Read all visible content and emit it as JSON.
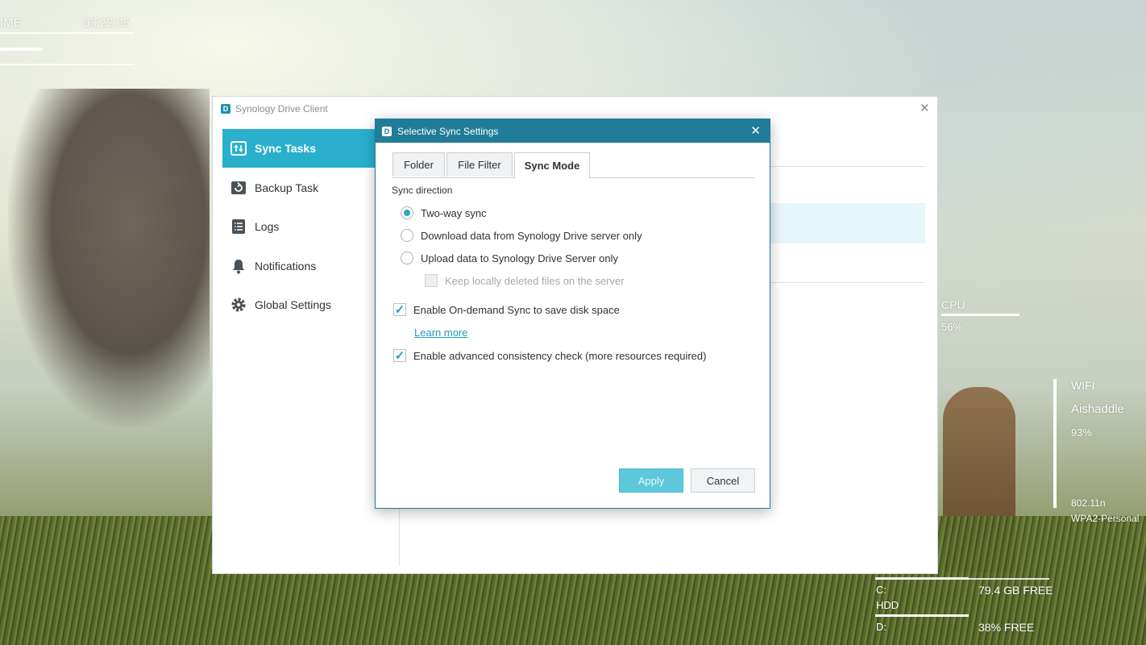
{
  "desktop": {
    "clock_label": "IME",
    "clock_time": "03:22:05",
    "cpu_label": "CPU",
    "cpu_value": "56%",
    "wifi_label": "WIFI",
    "wifi_network": "Aishaddle",
    "wifi_signal": "93%",
    "wifi_standard": "802.11n",
    "wifi_security": "WPA2-Personal",
    "drive_c_label": "C:",
    "drive_c_free": "79.4 GB FREE",
    "hdd_label": "HDD",
    "drive_d_label": "D:",
    "drive_d_free": "38% FREE"
  },
  "main_window": {
    "title": "Synology Drive Client",
    "logo_letter": "D",
    "close_icon": "close-icon",
    "nav": [
      {
        "label": "Sync Tasks",
        "icon": "sync-icon",
        "active": true
      },
      {
        "label": "Backup Task",
        "icon": "backup-icon",
        "active": false
      },
      {
        "label": "Logs",
        "icon": "logs-icon",
        "active": false
      },
      {
        "label": "Notifications",
        "icon": "bell-icon",
        "active": false
      },
      {
        "label": "Global Settings",
        "icon": "gear-icon",
        "active": false
      }
    ]
  },
  "dialog": {
    "title": "Selective Sync Settings",
    "logo_letter": "D",
    "tabs": [
      {
        "label": "Folder",
        "active": false
      },
      {
        "label": "File Filter",
        "active": false
      },
      {
        "label": "Sync Mode",
        "active": true
      }
    ],
    "section_label": "Sync direction",
    "options": {
      "two_way": "Two-way sync",
      "download_only": "Download data from Synology Drive server only",
      "upload_only": "Upload data to Synology Drive Server only",
      "keep_deleted": "Keep locally deleted files on the server",
      "on_demand": "Enable On-demand Sync to save disk space",
      "learn_more": "Learn more",
      "consistency": "Enable advanced consistency check (more resources required)"
    },
    "selected_direction": "two_way",
    "on_demand_checked": true,
    "consistency_checked": true,
    "keep_deleted_checked": false,
    "apply_label": "Apply",
    "cancel_label": "Cancel"
  },
  "colors": {
    "accent": "#2ab0cc",
    "dialog_title_bar": "#207c99",
    "apply_button": "#5ec8db"
  }
}
